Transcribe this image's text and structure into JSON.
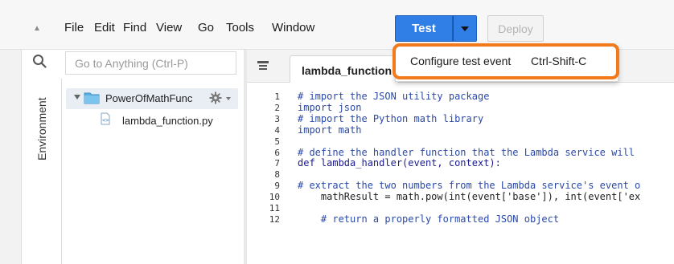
{
  "menu": {
    "items": [
      "File",
      "Edit",
      "Find",
      "View",
      "Go",
      "Tools",
      "Window"
    ],
    "test_label": "Test",
    "deploy_label": "Deploy"
  },
  "dropdown": {
    "item_label": "Configure test event",
    "shortcut": "Ctrl-Shift-C"
  },
  "sidebar": {
    "search_placeholder": "Go to Anything (Ctrl-P)",
    "env_tab_label": "Environment",
    "tree": {
      "root_label": "PowerOfMathFunc",
      "file_label": "lambda_function.py"
    }
  },
  "editor": {
    "tab_label": "lambda_function",
    "lines": [
      {
        "n": "1",
        "text": "# import the JSON utility package"
      },
      {
        "n": "2",
        "text": "import json"
      },
      {
        "n": "3",
        "text": "# import the Python math library"
      },
      {
        "n": "4",
        "text": "import math"
      },
      {
        "n": "5",
        "text": ""
      },
      {
        "n": "6",
        "text": "# define the handler function that the Lambda service will"
      },
      {
        "n": "7",
        "text": "def lambda_handler(event, context):"
      },
      {
        "n": "8",
        "text": ""
      },
      {
        "n": "9",
        "text": "# extract the two numbers from the Lambda service's event o"
      },
      {
        "n": "10",
        "text": "    mathResult = math.pow(int(event['base']), int(event['ex"
      },
      {
        "n": "11",
        "text": ""
      },
      {
        "n": "12",
        "text": "    # return a properly formatted JSON object"
      }
    ]
  },
  "colors": {
    "accent": "#2f7fe6",
    "highlight": "#f27a1a"
  },
  "icons": {
    "search": "search-icon",
    "folder": "folder-icon",
    "file": "python-file-icon",
    "gear": "gear-icon"
  }
}
